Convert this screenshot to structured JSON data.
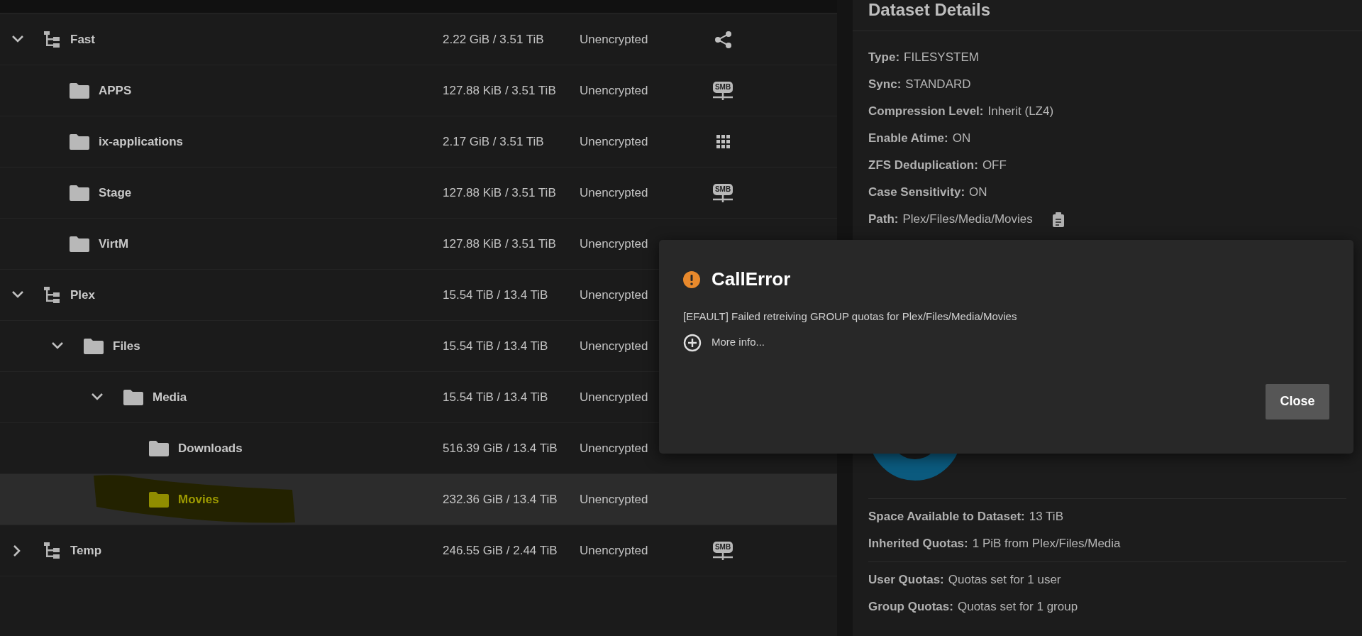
{
  "datasets": [
    {
      "name": "Fast",
      "used": "2.22 GiB / 3.51 TiB",
      "encryption": "Unencrypted",
      "has_children": true,
      "expanded": true,
      "selected": false,
      "highlighted": false,
      "badge": {
        "kind": "shared"
      },
      "children": [
        {
          "name": "APPS",
          "used": "127.88 KiB / 3.51 TiB",
          "encryption": "Unencrypted",
          "has_children": false,
          "selected": false,
          "highlighted": false,
          "badge": {
            "kind": "smb",
            "label": "SMB"
          }
        },
        {
          "name": "ix-applications",
          "used": "2.17 GiB / 3.51 TiB",
          "encryption": "Unencrypted",
          "has_children": false,
          "selected": false,
          "highlighted": false,
          "badge": {
            "kind": "apps"
          }
        },
        {
          "name": "Stage",
          "used": "127.88 KiB / 3.51 TiB",
          "encryption": "Unencrypted",
          "has_children": false,
          "selected": false,
          "highlighted": false,
          "badge": {
            "kind": "smb",
            "label": "SMB"
          }
        },
        {
          "name": "VirtM",
          "used": "127.88 KiB / 3.51 TiB",
          "encryption": "Unencrypted",
          "has_children": false,
          "selected": false,
          "highlighted": false
        }
      ]
    },
    {
      "name": "Plex",
      "used": "15.54 TiB / 13.4 TiB",
      "encryption": "Unencrypted",
      "has_children": true,
      "expanded": true,
      "selected": false,
      "highlighted": false,
      "children": [
        {
          "name": "Files",
          "used": "15.54 TiB / 13.4 TiB",
          "encryption": "Unencrypted",
          "has_children": true,
          "expanded": true,
          "selected": false,
          "highlighted": false,
          "children": [
            {
              "name": "Media",
              "used": "15.54 TiB / 13.4 TiB",
              "encryption": "Unencrypted",
              "has_children": true,
              "expanded": true,
              "selected": false,
              "highlighted": false,
              "children": [
                {
                  "name": "Downloads",
                  "used": "516.39 GiB / 13.4 TiB",
                  "encryption": "Unencrypted",
                  "has_children": false,
                  "selected": false,
                  "highlighted": false
                },
                {
                  "name": "Movies",
                  "used": "232.36 GiB / 13.4 TiB",
                  "encryption": "Unencrypted",
                  "has_children": false,
                  "selected": true,
                  "highlighted": true
                }
              ]
            }
          ]
        }
      ]
    },
    {
      "name": "Temp",
      "used": "246.55 GiB / 2.44 TiB",
      "encryption": "Unencrypted",
      "has_children": true,
      "expanded": false,
      "selected": false,
      "highlighted": false,
      "badge": {
        "kind": "smb",
        "label": "SMB"
      }
    }
  ],
  "details": {
    "title": "Dataset Details",
    "fields": [
      {
        "label": "Type:",
        "value": "FILESYSTEM",
        "copyable": false
      },
      {
        "label": "Sync:",
        "value": "STANDARD",
        "copyable": false
      },
      {
        "label": "Compression Level:",
        "value": "Inherit (LZ4)",
        "copyable": false
      },
      {
        "label": "Enable Atime:",
        "value": "ON",
        "copyable": false
      },
      {
        "label": "ZFS Deduplication:",
        "value": "OFF",
        "copyable": false
      },
      {
        "label": "Case Sensitivity:",
        "value": "ON",
        "copyable": false
      },
      {
        "label": "Path:",
        "value": "Plex/Files/Media/Movies",
        "copyable": true
      }
    ],
    "space": [
      {
        "label": "Space Available to Dataset:",
        "value": "13 TiB"
      },
      {
        "label": "Inherited Quotas:",
        "value": "1 PiB from Plex/Files/Media"
      }
    ],
    "quotas": [
      {
        "label": "User Quotas:",
        "value": "Quotas set for 1 user"
      },
      {
        "label": "Group Quotas:",
        "value": "Quotas set for 1 group"
      }
    ]
  },
  "dialog": {
    "title": "CallError",
    "message": "[EFAULT] Failed retreiving GROUP quotas for Plex/Files/Media/Movies",
    "more_info": "More info...",
    "buttons": [
      "Close"
    ]
  }
}
